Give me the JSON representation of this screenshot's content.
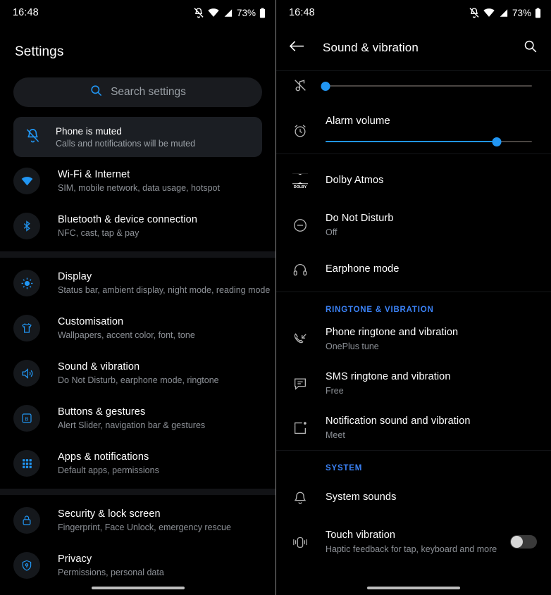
{
  "status_bar": {
    "time": "16:48",
    "battery_text": "73%",
    "icons": [
      "bell-muted-icon",
      "wifi-icon",
      "signal-icon",
      "battery-icon"
    ]
  },
  "left_panel": {
    "title": "Settings",
    "search": {
      "placeholder": "Search settings",
      "icon": "search-icon"
    },
    "muted_card": {
      "icon": "bell-muted-icon",
      "title": "Phone is muted",
      "subtitle": "Calls and notifications will be muted"
    },
    "groups": [
      {
        "items": [
          {
            "icon": "wifi-icon",
            "title": "Wi-Fi & Internet",
            "subtitle": "SIM, mobile network, data usage, hotspot"
          },
          {
            "icon": "bluetooth-icon",
            "title": "Bluetooth & device connection",
            "subtitle": "NFC, cast, tap & pay"
          }
        ]
      },
      {
        "items": [
          {
            "icon": "brightness-icon",
            "title": "Display",
            "subtitle": "Status bar, ambient display, night mode, reading mode"
          },
          {
            "icon": "tshirt-icon",
            "title": "Customisation",
            "subtitle": "Wallpapers, accent color, font, tone"
          },
          {
            "icon": "speaker-icon",
            "title": "Sound & vibration",
            "subtitle": "Do Not Disturb, earphone mode, ringtone"
          },
          {
            "icon": "button-b-icon",
            "title": "Buttons & gestures",
            "subtitle": "Alert Slider, navigation bar & gestures"
          },
          {
            "icon": "apps-grid-icon",
            "title": "Apps & notifications",
            "subtitle": "Default apps, permissions"
          }
        ]
      },
      {
        "items": [
          {
            "icon": "lock-icon",
            "title": "Security & lock screen",
            "subtitle": "Fingerprint, Face Unlock, emergency rescue"
          },
          {
            "icon": "shield-icon",
            "title": "Privacy",
            "subtitle": "Permissions, personal data"
          }
        ]
      }
    ]
  },
  "right_panel": {
    "toolbar": {
      "back_icon": "back-arrow-icon",
      "title": "Sound & vibration",
      "search_icon": "search-icon"
    },
    "volume_sliders": [
      {
        "icon": "music-note-muted-icon",
        "label": "",
        "value": 0,
        "max": 100
      },
      {
        "icon": "alarm-clock-icon",
        "label": "Alarm volume",
        "value": 83,
        "max": 100
      }
    ],
    "sections": [
      {
        "label": "",
        "items": [
          {
            "icon": "dolby-icon",
            "title": "Dolby Atmos",
            "subtitle": ""
          },
          {
            "icon": "do-not-disturb-icon",
            "title": "Do Not Disturb",
            "subtitle": "Off"
          },
          {
            "icon": "headphones-icon",
            "title": "Earphone mode",
            "subtitle": ""
          }
        ]
      },
      {
        "label": "RINGTONE & VIBRATION",
        "items": [
          {
            "icon": "phone-ring-icon",
            "title": "Phone ringtone and vibration",
            "subtitle": "OnePlus tune"
          },
          {
            "icon": "message-icon",
            "title": "SMS ringtone and vibration",
            "subtitle": "Free"
          },
          {
            "icon": "notification-box-icon",
            "title": "Notification sound and vibration",
            "subtitle": "Meet"
          }
        ]
      },
      {
        "label": "SYSTEM",
        "items": [
          {
            "icon": "bell-icon",
            "title": "System sounds",
            "subtitle": ""
          },
          {
            "icon": "vibration-icon",
            "title": "Touch vibration",
            "subtitle": "Haptic feedback for tap, keyboard and more",
            "toggle": "off"
          }
        ]
      }
    ]
  },
  "colors": {
    "accent_blue": "#2196f3",
    "section_label_blue": "#3b82f6",
    "background": "#000000",
    "card": "#1b1e23",
    "secondary_text": "#8d9197"
  }
}
